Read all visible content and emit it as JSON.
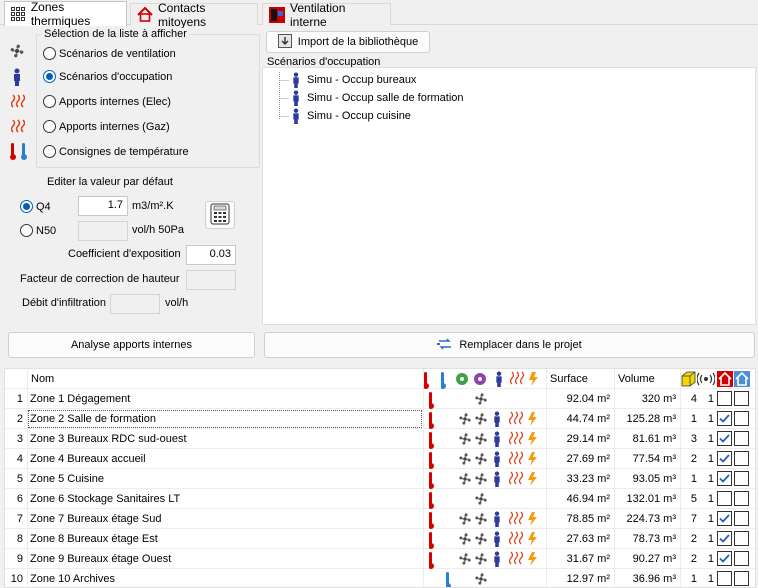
{
  "tabs": [
    {
      "label": "Zones thermiques",
      "active": true
    },
    {
      "label": "Contacts mitoyens",
      "active": false
    },
    {
      "label": "Ventilation interne",
      "active": false
    }
  ],
  "selection": {
    "title": "Sélection de la liste à afficher",
    "options": [
      "Scénarios de ventilation",
      "Scénarios d'occupation",
      "Apports internes (Elec)",
      "Apports internes (Gaz)",
      "Consignes de température"
    ],
    "selected": "Scénarios d'occupation"
  },
  "defaults": {
    "title": "Editer la valeur par défaut",
    "q4_label": "Q4",
    "q4_value": "1.7",
    "q4_unit": "m3/m².K",
    "n50_label": "N50",
    "n50_value": "",
    "n50_unit": "vol/h 50Pa",
    "exposure_label": "Coefficient d'exposition",
    "exposure_value": "0.03",
    "height_label": "Facteur de correction de hauteur",
    "height_value": "",
    "infiltration_label": "Débit d'infiltration",
    "infiltration_value": "",
    "infiltration_unit": "vol/h"
  },
  "library": {
    "import_button": "Import de la bibliothèque",
    "list_title": "Scénarios d'occupation",
    "items": [
      "Simu - Occup bureaux",
      "Simu - Occup salle de formation",
      "Simu - Occup cuisine"
    ]
  },
  "actions": {
    "analyse_button": "Analyse apports internes",
    "replace_button": "Remplacer dans le projet"
  },
  "table": {
    "headers": {
      "name": "Nom",
      "surface": "Surface",
      "volume": "Volume"
    },
    "rows": [
      {
        "idx": "1",
        "name": "Zone 1 Dégagement",
        "surface": "92.04 m²",
        "volume": "320 m³",
        "n": "4",
        "m": "1",
        "thermo": "red",
        "icons": [
          "fan"
        ],
        "checked": false
      },
      {
        "idx": "2",
        "name": "Zone 2 Salle de formation",
        "surface": "44.74 m²",
        "volume": "125.28 m³",
        "n": "1",
        "m": "1",
        "thermo": "red",
        "icons": [
          "fan",
          "fan",
          "person",
          "heat",
          "gas"
        ],
        "checked": true
      },
      {
        "idx": "3",
        "name": "Zone 3 Bureaux RDC sud-ouest",
        "surface": "29.14 m²",
        "volume": "81.61 m³",
        "n": "3",
        "m": "1",
        "thermo": "red",
        "icons": [
          "fan",
          "fan",
          "person",
          "heat",
          "gas"
        ],
        "checked": true
      },
      {
        "idx": "4",
        "name": "Zone 4 Bureaux accueil",
        "surface": "27.69 m²",
        "volume": "77.54 m³",
        "n": "2",
        "m": "1",
        "thermo": "red",
        "icons": [
          "fan",
          "fan",
          "person",
          "heat",
          "gas"
        ],
        "checked": true
      },
      {
        "idx": "5",
        "name": "Zone 5 Cuisine",
        "surface": "33.23 m²",
        "volume": "93.05 m³",
        "n": "1",
        "m": "1",
        "thermo": "red",
        "icons": [
          "fan",
          "fan",
          "person",
          "heat",
          "gas"
        ],
        "checked": true
      },
      {
        "idx": "6",
        "name": "Zone 6 Stockage Sanitaires LT",
        "surface": "46.94 m²",
        "volume": "132.01 m³",
        "n": "5",
        "m": "1",
        "thermo": "red",
        "icons": [
          "fan"
        ],
        "checked": false
      },
      {
        "idx": "7",
        "name": "Zone 7 Bureaux étage Sud",
        "surface": "78.85 m²",
        "volume": "224.73 m³",
        "n": "7",
        "m": "1",
        "thermo": "red",
        "icons": [
          "fan",
          "fan",
          "person",
          "heat",
          "gas"
        ],
        "checked": true
      },
      {
        "idx": "8",
        "name": "Zone 8 Bureaux étage Est",
        "surface": "27.63 m²",
        "volume": "78.73 m³",
        "n": "2",
        "m": "1",
        "thermo": "red",
        "icons": [
          "fan",
          "fan",
          "person",
          "heat",
          "gas"
        ],
        "checked": true
      },
      {
        "idx": "9",
        "name": "Zone 9 Bureaux étage Ouest",
        "surface": "31.67 m²",
        "volume": "90.27 m³",
        "n": "2",
        "m": "1",
        "thermo": "red",
        "icons": [
          "fan",
          "fan",
          "person",
          "heat",
          "gas"
        ],
        "checked": true
      },
      {
        "idx": "10",
        "name": "Zone 10 Archives",
        "surface": "12.97 m²",
        "volume": "36.96 m³",
        "n": "1",
        "m": "1",
        "thermo": "blue",
        "icons": [
          "fan"
        ],
        "checked": false
      }
    ]
  }
}
